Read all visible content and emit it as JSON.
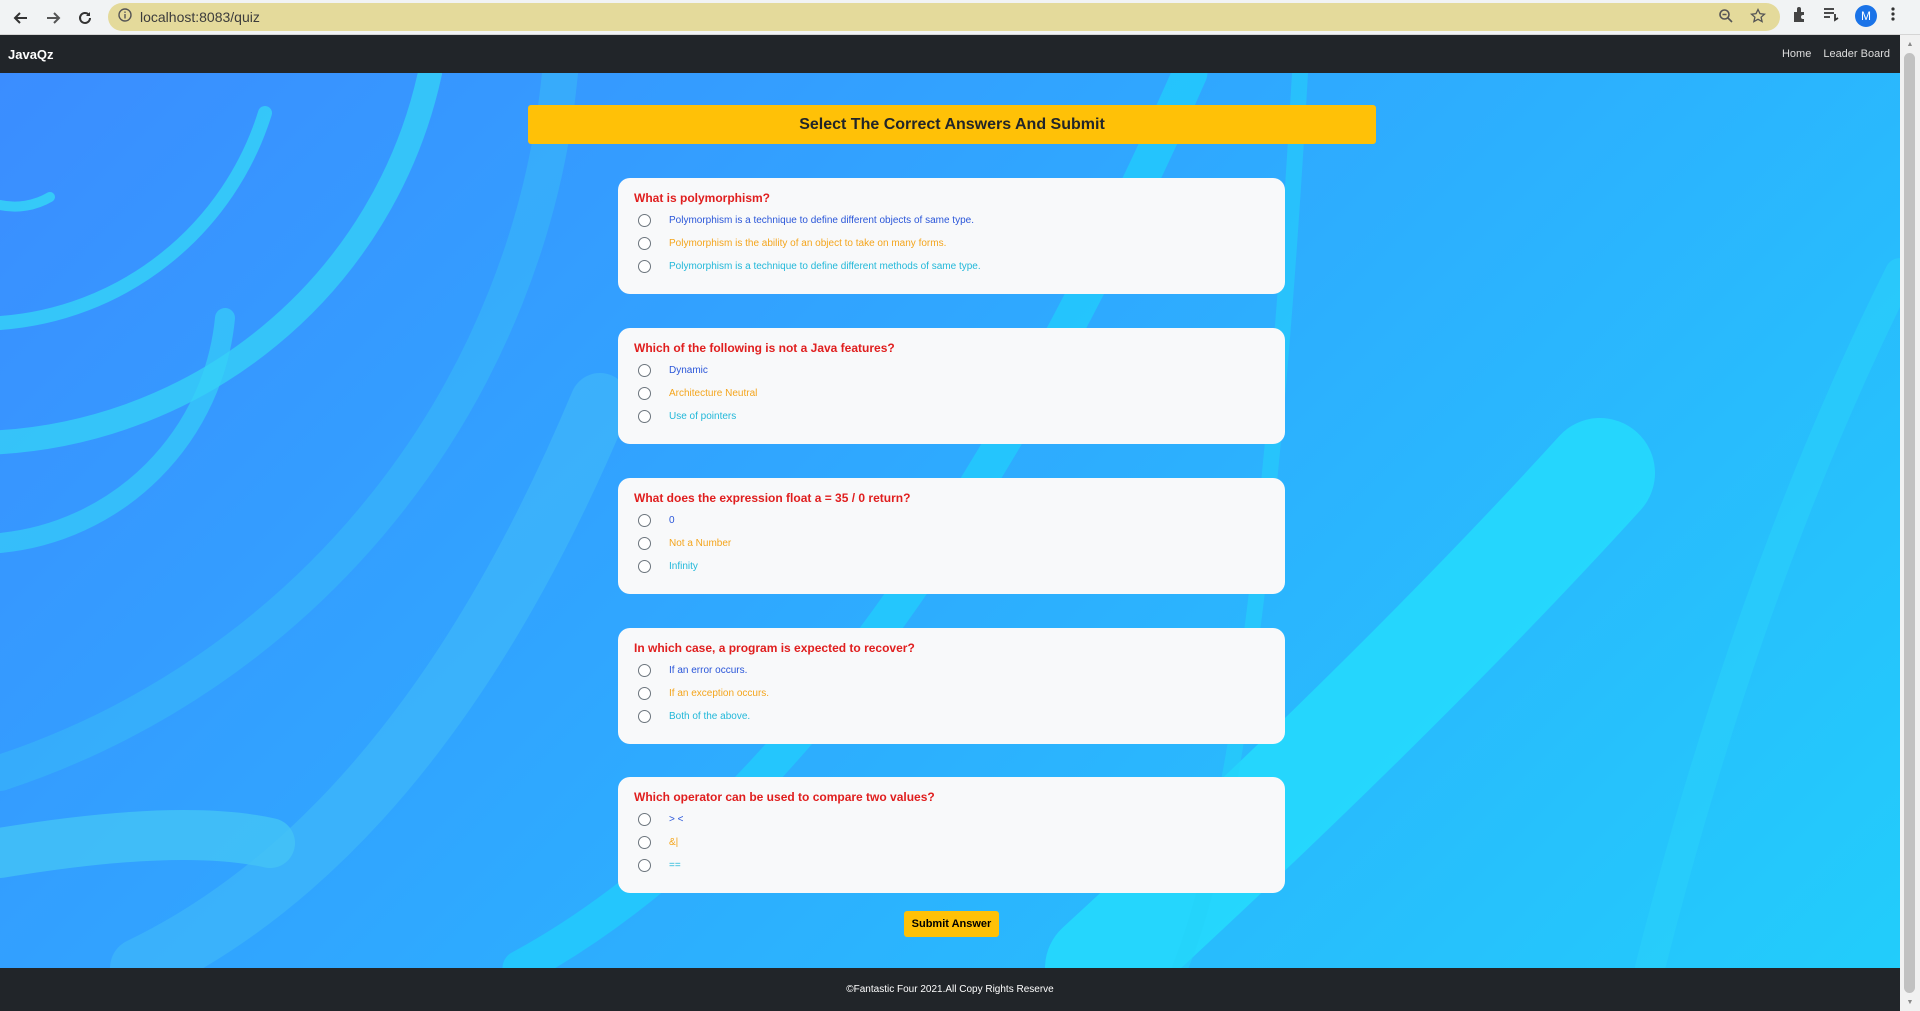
{
  "browser": {
    "url": "localhost:8083/quiz",
    "avatar_letter": "M"
  },
  "navbar": {
    "brand": "JavaQz",
    "links": [
      "Home",
      "Leader Board"
    ]
  },
  "page": {
    "header": "Select The Correct Answers And Submit",
    "submit_label": "Submit Answer",
    "footer": "©Fantastic Four 2021.All Copy Rights Reserve"
  },
  "questions": [
    {
      "question": "What is polymorphism?",
      "options": [
        "Polymorphism is a technique to define different objects of same type.",
        "Polymorphism is the ability of an object to take on many forms.",
        "Polymorphism is a technique to define different methods of same type."
      ]
    },
    {
      "question": "Which of the following is not a Java features?",
      "options": [
        "Dynamic",
        "Architecture Neutral",
        "Use of pointers"
      ]
    },
    {
      "question": "What does the expression float a = 35 / 0 return?",
      "options": [
        "0",
        "Not a Number",
        "Infinity"
      ]
    },
    {
      "question": "In which case, a program is expected to recover?",
      "options": [
        "If an error occurs.",
        "If an exception occurs.",
        "Both of the above."
      ]
    },
    {
      "question": "Which operator can be used to compare two values?",
      "options": [
        "> <",
        "&|",
        "=="
      ]
    }
  ],
  "colors": {
    "accent": "#ffc107",
    "question_text": "#e01e1e",
    "navbar": "#212529",
    "option_1": "#2a56d9",
    "option_2": "#f4a51c",
    "option_3": "#22b8d9"
  }
}
